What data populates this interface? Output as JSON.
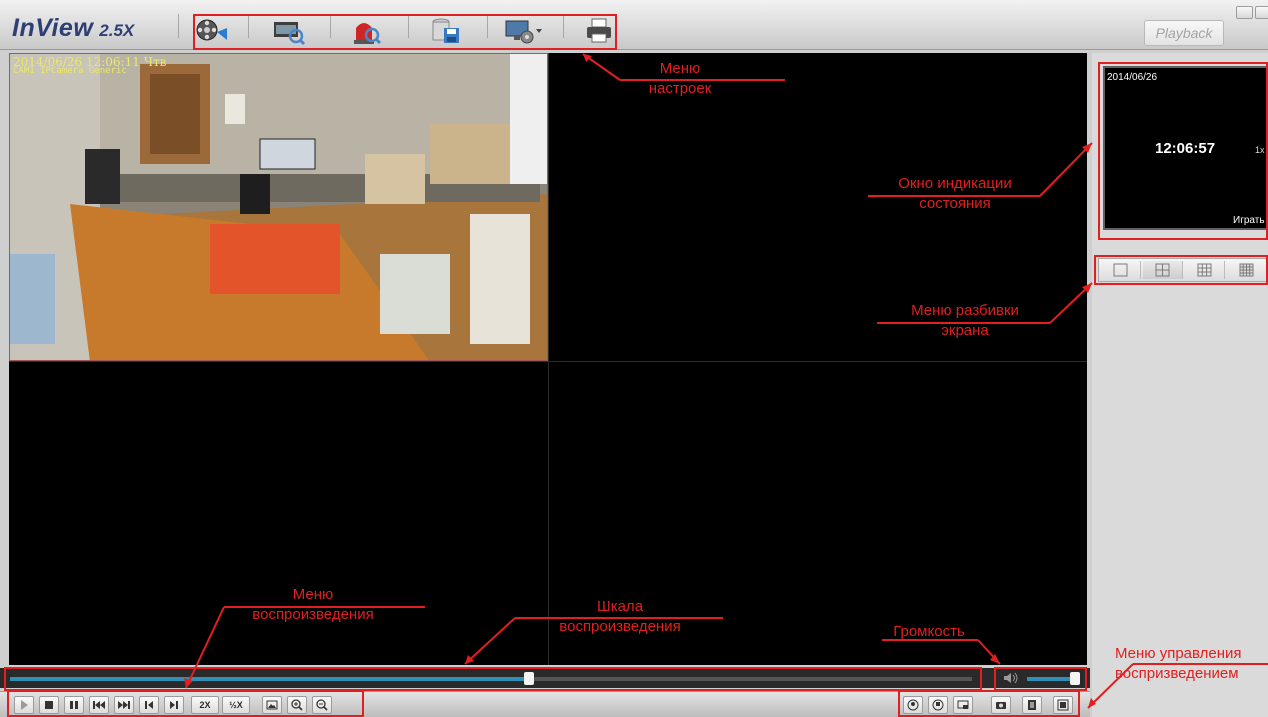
{
  "app": {
    "brand": "InView",
    "version": "2.5X"
  },
  "toolbar": {
    "items": [
      {
        "name": "camera-reel-icon"
      },
      {
        "name": "search-video-icon"
      },
      {
        "name": "alarm-search-icon"
      },
      {
        "name": "backup-storage-icon"
      },
      {
        "name": "settings-display-icon"
      },
      {
        "name": "print-icon"
      }
    ],
    "playback_label": "Playback"
  },
  "camera": {
    "osd_datetime": "2014/06/26 12:06:11 Чтв",
    "osd_camera": "CAM1 IPCamera Generic"
  },
  "status_window": {
    "date": "2014/06/26",
    "time": "12:06:57",
    "speed": "1x",
    "state": "Играть"
  },
  "split_menu": [
    "1x1",
    "2x2",
    "3x3",
    "4x4"
  ],
  "split_active": 1,
  "seek": {
    "progress": 0.54
  },
  "volume": {
    "level": 0.95
  },
  "playback_controls": [
    {
      "id": "play",
      "name": "play-button"
    },
    {
      "id": "stop",
      "name": "stop-button"
    },
    {
      "id": "pause",
      "name": "pause-button"
    },
    {
      "id": "rew",
      "name": "fast-rewind-button"
    },
    {
      "id": "ff",
      "name": "fast-forward-button"
    },
    {
      "id": "prev",
      "name": "prev-frame-button"
    },
    {
      "id": "next",
      "name": "next-frame-button"
    },
    {
      "id": "x2",
      "name": "speed-2x-button",
      "label": "2X"
    },
    {
      "id": "half",
      "name": "speed-half-button",
      "label": "½X"
    },
    {
      "id": "img",
      "name": "image-button"
    },
    {
      "id": "zin",
      "name": "zoom-in-button"
    },
    {
      "id": "zout",
      "name": "zoom-out-button"
    }
  ],
  "right_controls": [
    {
      "name": "audio-on-button"
    },
    {
      "name": "audio-off-button"
    },
    {
      "name": "window-button"
    },
    {
      "name": "snapshot-button"
    },
    {
      "name": "record-button"
    },
    {
      "name": "fullscreen-button"
    }
  ],
  "annotations": {
    "settings_menu": "Меню\nнастроек",
    "status_window": "Окно индикации\nсостояния",
    "split_menu": "Меню разбивки\nэкрана",
    "playback_menu": "Меню\nвоспроизведения",
    "seek_scale": "Шкала\nвоспроизведения",
    "volume": "Громкость",
    "playback_control_menu": "Меню управления\nвоспризведением"
  },
  "colors": {
    "annotation": "#e02020",
    "accent": "#2f8fb6",
    "logo": "#2d3f74"
  }
}
